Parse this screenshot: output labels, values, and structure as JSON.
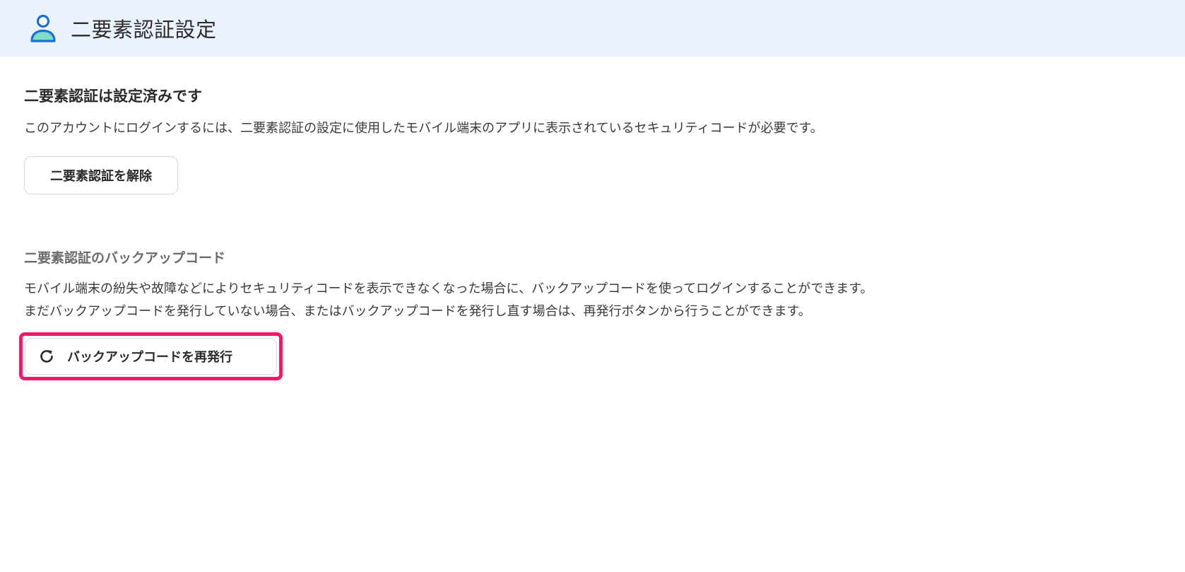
{
  "header": {
    "title": "二要素認証設定",
    "icon": "user-icon"
  },
  "two_factor": {
    "title": "二要素認証は設定済みです",
    "description": "このアカウントにログインするには、二要素認証の設定に使用したモバイル端末のアプリに表示されているセキュリティコードが必要です。",
    "disable_button_label": "二要素認証を解除"
  },
  "backup_codes": {
    "title": "二要素認証のバックアップコード",
    "description_line1": "モバイル端末の紛失や故障などによりセキュリティコードを表示できなくなった場合に、バックアップコードを使ってログインすることができます。",
    "description_line2": "まだバックアップコードを発行していない場合、またはバックアップコードを発行し直す場合は、再発行ボタンから行うことができます。",
    "reissue_button_label": "バックアップコードを再発行",
    "reissue_icon": "refresh-icon"
  },
  "colors": {
    "header_bg": "#eaf2fe",
    "icon_blue": "#1c6fd1",
    "icon_teal": "#7fdcc8",
    "highlight": "#f0196a"
  }
}
